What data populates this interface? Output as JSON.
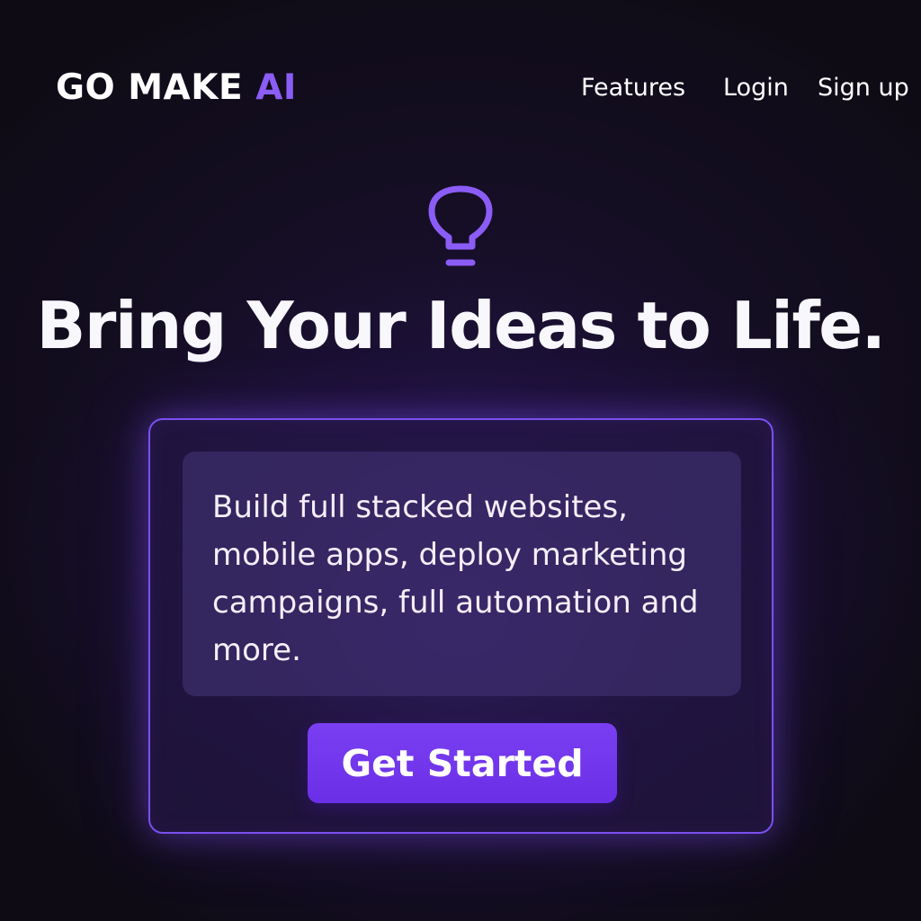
{
  "header": {
    "brand": {
      "main": "GO MAKE ",
      "accent": "AI"
    },
    "nav": {
      "features": "Features",
      "login": "Login",
      "signup": "Sign up"
    }
  },
  "hero": {
    "icon": "lightbulb-icon",
    "headline": "Bring Your Ideas to Life."
  },
  "card": {
    "description": "Build full stacked websites, mobile apps, deploy marketing campaigns, full automation and more.",
    "cta_label": "Get Started"
  },
  "colors": {
    "background": "#0e0b14",
    "accent": "#8b5cf6",
    "button": "#7b3ff2",
    "card_border": "#7c4ff0"
  }
}
